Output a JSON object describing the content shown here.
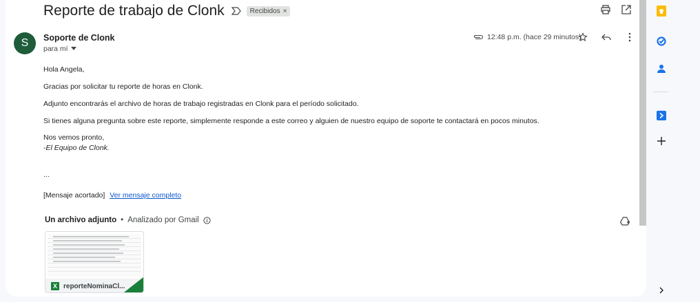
{
  "email": {
    "subject": "Reporte de trabajo de Clonk",
    "label": "Recibidos",
    "label_remove": "×",
    "sender_initial": "S",
    "sender_name": "Soporte de Clonk",
    "recipient": "para mí",
    "time": "12:48 p.m. (hace 29 minutos)",
    "body": {
      "greeting": "Hola Angela,",
      "line1": "Gracias por solicitar tu reporte de horas en Clonk.",
      "line2": "Adjunto encontrarás el archivo de horas de trabajo registradas en Clonk para el período solicitado.",
      "line3": "Si tienes alguna pregunta sobre este reporte, simplemente responde a este correo y alguien de nuestro equipo de soporte te contactará en pocos minutos.",
      "closing": "Nos vemos pronto,",
      "signature": "-El Equipo de Clonk.",
      "ellipsis": "...",
      "trimmed": "[Mensaje acortado]",
      "view_full": "Ver mensaje completo"
    },
    "attachments": {
      "title": "Un archivo adjunto",
      "separator": "•",
      "scanned": "Analizado por Gmail",
      "file_name": "reporteNominaCl...",
      "file_icon_letter": "X"
    }
  },
  "icons": {
    "print": "printer-icon",
    "open_new": "open-in-new-window-icon",
    "important": "label-important-icon",
    "attachment": "paperclip-icon",
    "star": "star-icon",
    "reply": "reply-icon",
    "more": "more-vert-icon",
    "info": "info-icon",
    "add_drive": "add-to-drive-icon"
  },
  "side_panel": {
    "items": [
      "keep-icon",
      "tasks-icon",
      "contacts-icon",
      "extension-icon",
      "add-icon"
    ],
    "expand": "chevron-right-icon"
  },
  "colors": {
    "avatar": "#1e5c3a",
    "link": "#0b57d0",
    "excel": "#188038",
    "keep": "#fbbc04",
    "tasks": "#1a73e8",
    "contacts": "#1a73e8"
  }
}
